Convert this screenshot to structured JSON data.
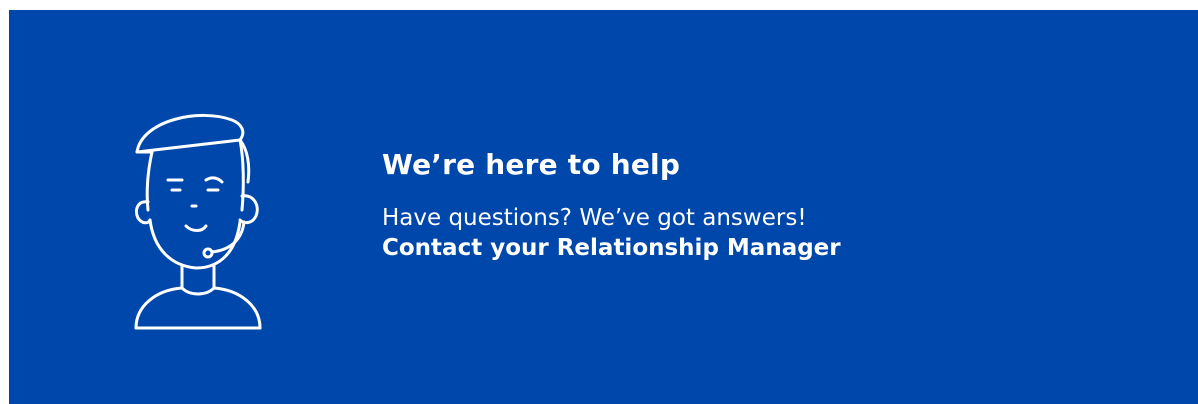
{
  "banner": {
    "heading": "We’re here to help",
    "subtext": "Have questions? We’ve got answers!",
    "contact_link": "Contact your Relationship Manager",
    "icon": "support-agent-headset-icon"
  },
  "colors": {
    "background": "#0047ab",
    "foreground": "#ffffff"
  }
}
